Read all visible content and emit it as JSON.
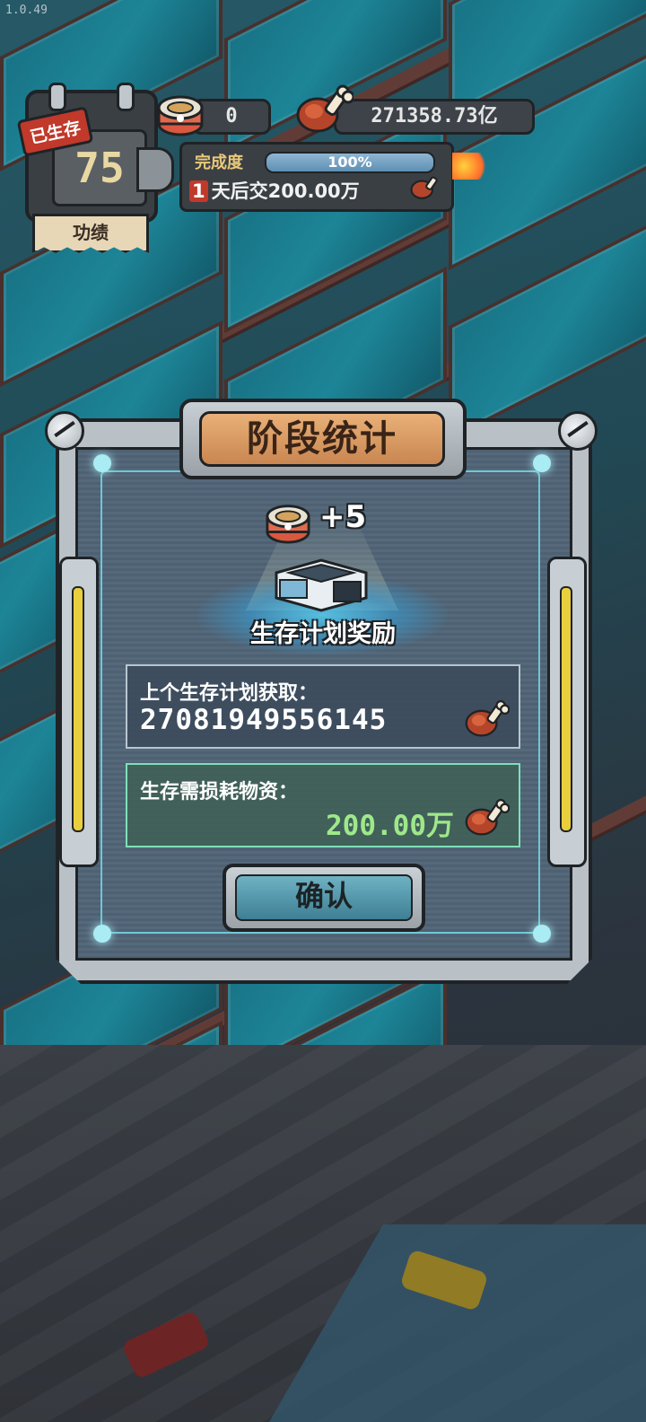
{
  "version": "1.0.49",
  "hud": {
    "survived_tag": "已生存",
    "survived_days": "75",
    "merit_label": "功绩",
    "cans": "0",
    "meat": "271358.73亿",
    "progress": {
      "label": "完成度",
      "percent_text": "100%",
      "percent_value": 100
    },
    "deadline": {
      "days": "1",
      "text": "天后交",
      "amount": "200.00万"
    }
  },
  "modal": {
    "title": "阶段统计",
    "reward": {
      "count": "+5",
      "label": "生存计划奖励"
    },
    "previous_plan": {
      "label": "上个生存计划获取：",
      "value": "2708194955614 5"
    },
    "cost": {
      "label": "生存需损耗物资：",
      "value": "200.00万"
    },
    "confirm": "确认"
  },
  "icons": {
    "can": "can-icon",
    "meat": "meat-icon",
    "box": "crate-icon",
    "gear": "gear-icon"
  },
  "colors": {
    "title_plate": "#d99a62",
    "panel": "#4e6173",
    "accent_cyan": "#74d9e6",
    "cost_value": "#9ee88a",
    "tag_red": "#c0392b"
  }
}
